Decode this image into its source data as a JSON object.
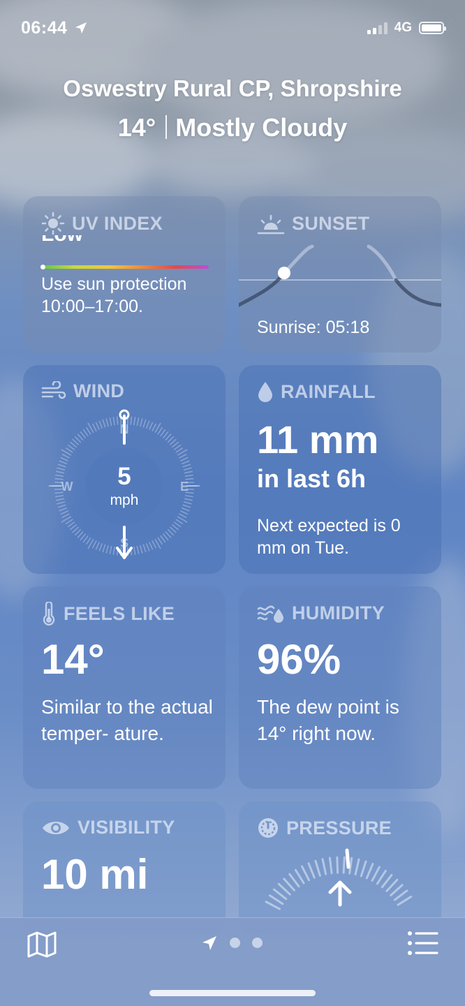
{
  "status_bar": {
    "time": "06:44",
    "network": "4G"
  },
  "header": {
    "location": "Oswestry Rural CP, Shropshire",
    "temperature": "14°",
    "condition": "Mostly Cloudy"
  },
  "uv": {
    "title": "UV INDEX",
    "level": "Low",
    "description": "Use sun protection 10:00–17:00."
  },
  "sunset": {
    "title": "SUNSET",
    "sunrise": "Sunrise: 05:18"
  },
  "wind": {
    "title": "WIND",
    "speed": "5",
    "unit": "mph",
    "n": "N",
    "s": "S",
    "e": "E",
    "w": "W"
  },
  "rainfall": {
    "title": "RAINFALL",
    "amount": "11 mm",
    "period": "in last 6h",
    "description": "Next expected is 0 mm on Tue."
  },
  "feels_like": {
    "title": "FEELS LIKE",
    "value": "14°",
    "description": "Similar to the actual temper- ature."
  },
  "humidity": {
    "title": "HUMIDITY",
    "value": "96%",
    "description": "The dew point is 14° right now."
  },
  "visibility": {
    "title": "VISIBILITY",
    "value": "10 mi"
  },
  "pressure": {
    "title": "PRESSURE"
  },
  "tab_bar": {
    "icons": [
      "map-icon",
      "location-arrow-icon",
      "page-dot",
      "page-dot",
      "list-icon"
    ]
  }
}
